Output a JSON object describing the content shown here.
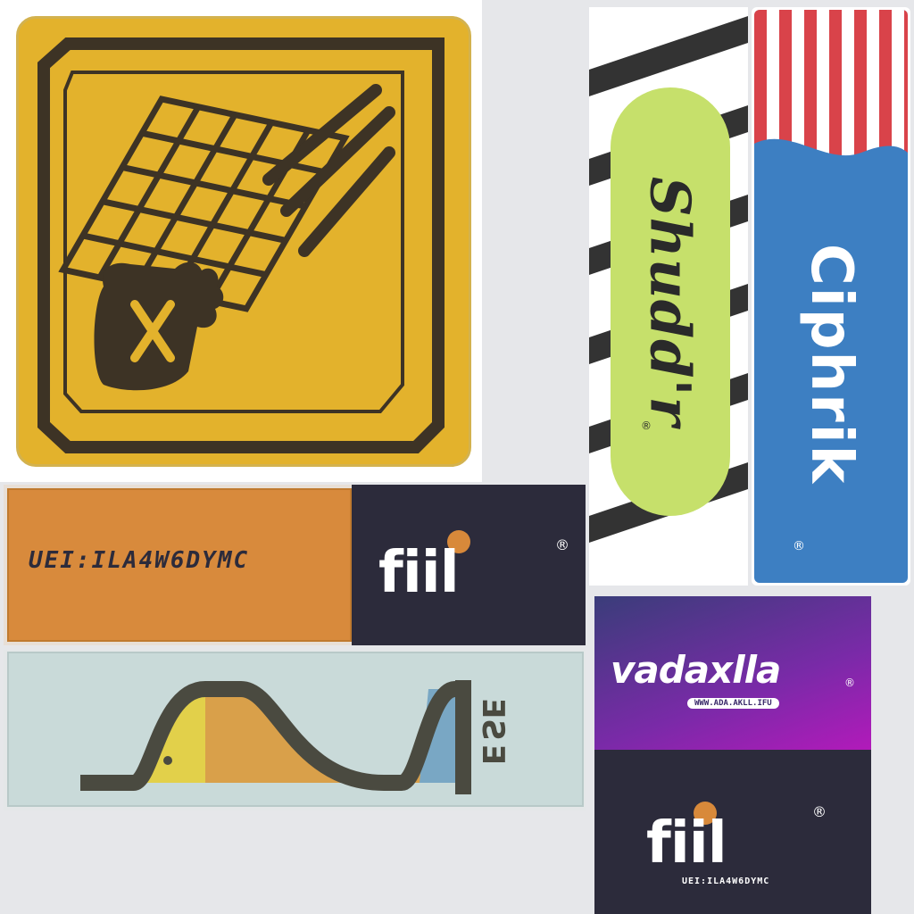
{
  "stickers": {
    "warning": {
      "name": "yellow warning sign sticker",
      "colors": {
        "bg": "#e3b22c",
        "frame": "#3d3325",
        "paper": "#ffffff"
      }
    },
    "shudder": {
      "script": "Shudd'r",
      "registered": "®",
      "colors": {
        "panel": "#c6e06b",
        "stripe_dark": "#333333",
        "stripe_light": "#ffffff"
      }
    },
    "crimson": {
      "script": "Ciphrik",
      "registered": "®",
      "colors": {
        "top_red": "#d9434a",
        "bottom_blue": "#3d7fc2"
      }
    },
    "orange_panel": {
      "left_text": "UEI:ILA4W6DYMC",
      "logo": "fiil",
      "registered": "®",
      "colors": {
        "left": "#d88a3c",
        "right": "#2c2b3b",
        "dot": "#d8893a"
      }
    },
    "sine_panel": {
      "vertical_text": "ƎƧƎ",
      "colors": {
        "bg": "#c9dad9",
        "curve": "#4a4a40",
        "yellow": "#e2d04a",
        "orange": "#d9a04a",
        "blue": "#79a7c4"
      }
    },
    "purple_panel": {
      "logo": "vadaxlla",
      "registered": "®",
      "url": "WWW.ADA.AKLL.IFU",
      "colors": {
        "from": "#3a3d7a",
        "to": "#b21aba"
      }
    },
    "dark_panel": {
      "logo": "fiil",
      "registered": "®",
      "tagline": "UEI:ILA4W6DYMC",
      "colors": {
        "bg": "#2c2b3b",
        "dot": "#d8893a"
      }
    }
  }
}
